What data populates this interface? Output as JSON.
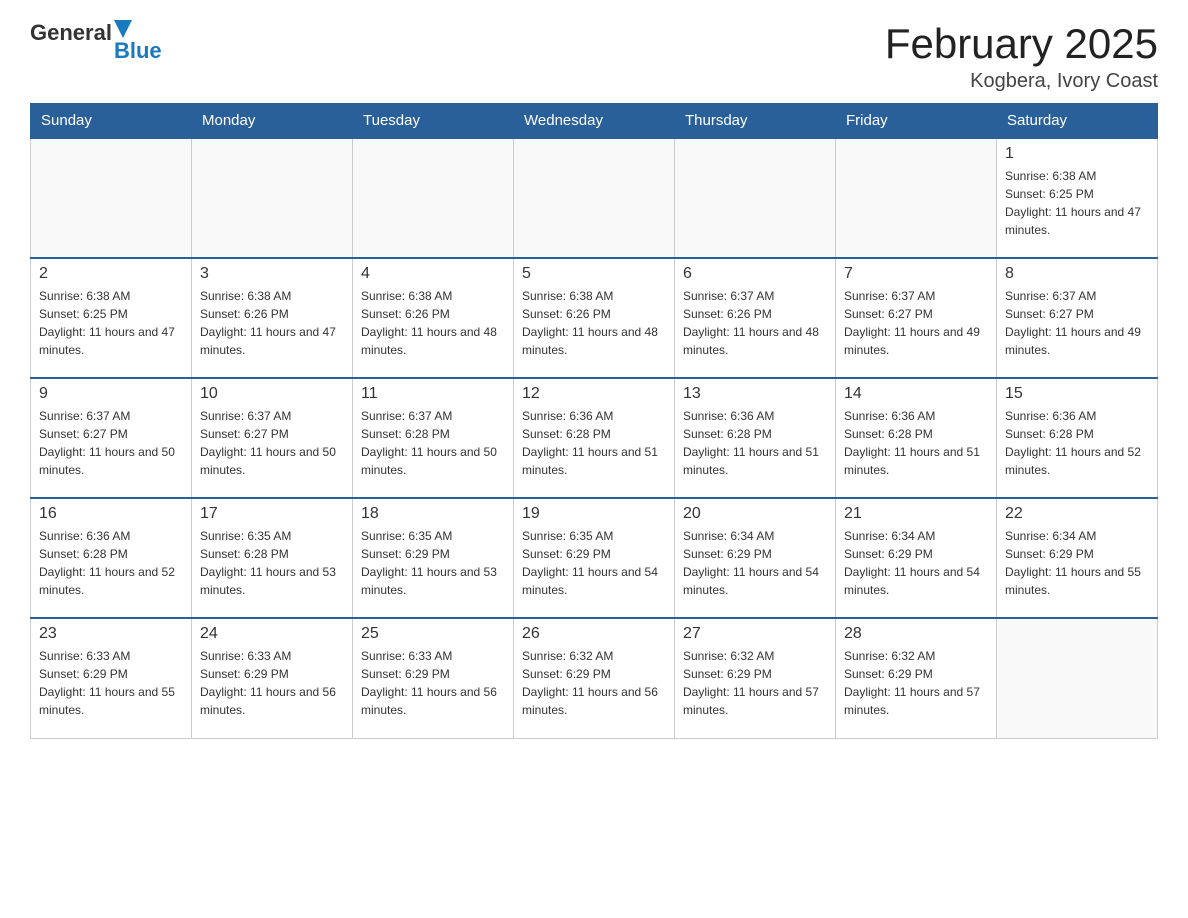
{
  "header": {
    "logo": {
      "general": "General",
      "blue": "Blue"
    },
    "title": "February 2025",
    "location": "Kogbera, Ivory Coast"
  },
  "weekdays": [
    "Sunday",
    "Monday",
    "Tuesday",
    "Wednesday",
    "Thursday",
    "Friday",
    "Saturday"
  ],
  "weeks": [
    [
      {
        "day": "",
        "info": ""
      },
      {
        "day": "",
        "info": ""
      },
      {
        "day": "",
        "info": ""
      },
      {
        "day": "",
        "info": ""
      },
      {
        "day": "",
        "info": ""
      },
      {
        "day": "",
        "info": ""
      },
      {
        "day": "1",
        "info": "Sunrise: 6:38 AM\nSunset: 6:25 PM\nDaylight: 11 hours and 47 minutes."
      }
    ],
    [
      {
        "day": "2",
        "info": "Sunrise: 6:38 AM\nSunset: 6:25 PM\nDaylight: 11 hours and 47 minutes."
      },
      {
        "day": "3",
        "info": "Sunrise: 6:38 AM\nSunset: 6:26 PM\nDaylight: 11 hours and 47 minutes."
      },
      {
        "day": "4",
        "info": "Sunrise: 6:38 AM\nSunset: 6:26 PM\nDaylight: 11 hours and 48 minutes."
      },
      {
        "day": "5",
        "info": "Sunrise: 6:38 AM\nSunset: 6:26 PM\nDaylight: 11 hours and 48 minutes."
      },
      {
        "day": "6",
        "info": "Sunrise: 6:37 AM\nSunset: 6:26 PM\nDaylight: 11 hours and 48 minutes."
      },
      {
        "day": "7",
        "info": "Sunrise: 6:37 AM\nSunset: 6:27 PM\nDaylight: 11 hours and 49 minutes."
      },
      {
        "day": "8",
        "info": "Sunrise: 6:37 AM\nSunset: 6:27 PM\nDaylight: 11 hours and 49 minutes."
      }
    ],
    [
      {
        "day": "9",
        "info": "Sunrise: 6:37 AM\nSunset: 6:27 PM\nDaylight: 11 hours and 50 minutes."
      },
      {
        "day": "10",
        "info": "Sunrise: 6:37 AM\nSunset: 6:27 PM\nDaylight: 11 hours and 50 minutes."
      },
      {
        "day": "11",
        "info": "Sunrise: 6:37 AM\nSunset: 6:28 PM\nDaylight: 11 hours and 50 minutes."
      },
      {
        "day": "12",
        "info": "Sunrise: 6:36 AM\nSunset: 6:28 PM\nDaylight: 11 hours and 51 minutes."
      },
      {
        "day": "13",
        "info": "Sunrise: 6:36 AM\nSunset: 6:28 PM\nDaylight: 11 hours and 51 minutes."
      },
      {
        "day": "14",
        "info": "Sunrise: 6:36 AM\nSunset: 6:28 PM\nDaylight: 11 hours and 51 minutes."
      },
      {
        "day": "15",
        "info": "Sunrise: 6:36 AM\nSunset: 6:28 PM\nDaylight: 11 hours and 52 minutes."
      }
    ],
    [
      {
        "day": "16",
        "info": "Sunrise: 6:36 AM\nSunset: 6:28 PM\nDaylight: 11 hours and 52 minutes."
      },
      {
        "day": "17",
        "info": "Sunrise: 6:35 AM\nSunset: 6:28 PM\nDaylight: 11 hours and 53 minutes."
      },
      {
        "day": "18",
        "info": "Sunrise: 6:35 AM\nSunset: 6:29 PM\nDaylight: 11 hours and 53 minutes."
      },
      {
        "day": "19",
        "info": "Sunrise: 6:35 AM\nSunset: 6:29 PM\nDaylight: 11 hours and 54 minutes."
      },
      {
        "day": "20",
        "info": "Sunrise: 6:34 AM\nSunset: 6:29 PM\nDaylight: 11 hours and 54 minutes."
      },
      {
        "day": "21",
        "info": "Sunrise: 6:34 AM\nSunset: 6:29 PM\nDaylight: 11 hours and 54 minutes."
      },
      {
        "day": "22",
        "info": "Sunrise: 6:34 AM\nSunset: 6:29 PM\nDaylight: 11 hours and 55 minutes."
      }
    ],
    [
      {
        "day": "23",
        "info": "Sunrise: 6:33 AM\nSunset: 6:29 PM\nDaylight: 11 hours and 55 minutes."
      },
      {
        "day": "24",
        "info": "Sunrise: 6:33 AM\nSunset: 6:29 PM\nDaylight: 11 hours and 56 minutes."
      },
      {
        "day": "25",
        "info": "Sunrise: 6:33 AM\nSunset: 6:29 PM\nDaylight: 11 hours and 56 minutes."
      },
      {
        "day": "26",
        "info": "Sunrise: 6:32 AM\nSunset: 6:29 PM\nDaylight: 11 hours and 56 minutes."
      },
      {
        "day": "27",
        "info": "Sunrise: 6:32 AM\nSunset: 6:29 PM\nDaylight: 11 hours and 57 minutes."
      },
      {
        "day": "28",
        "info": "Sunrise: 6:32 AM\nSunset: 6:29 PM\nDaylight: 11 hours and 57 minutes."
      },
      {
        "day": "",
        "info": ""
      }
    ]
  ]
}
